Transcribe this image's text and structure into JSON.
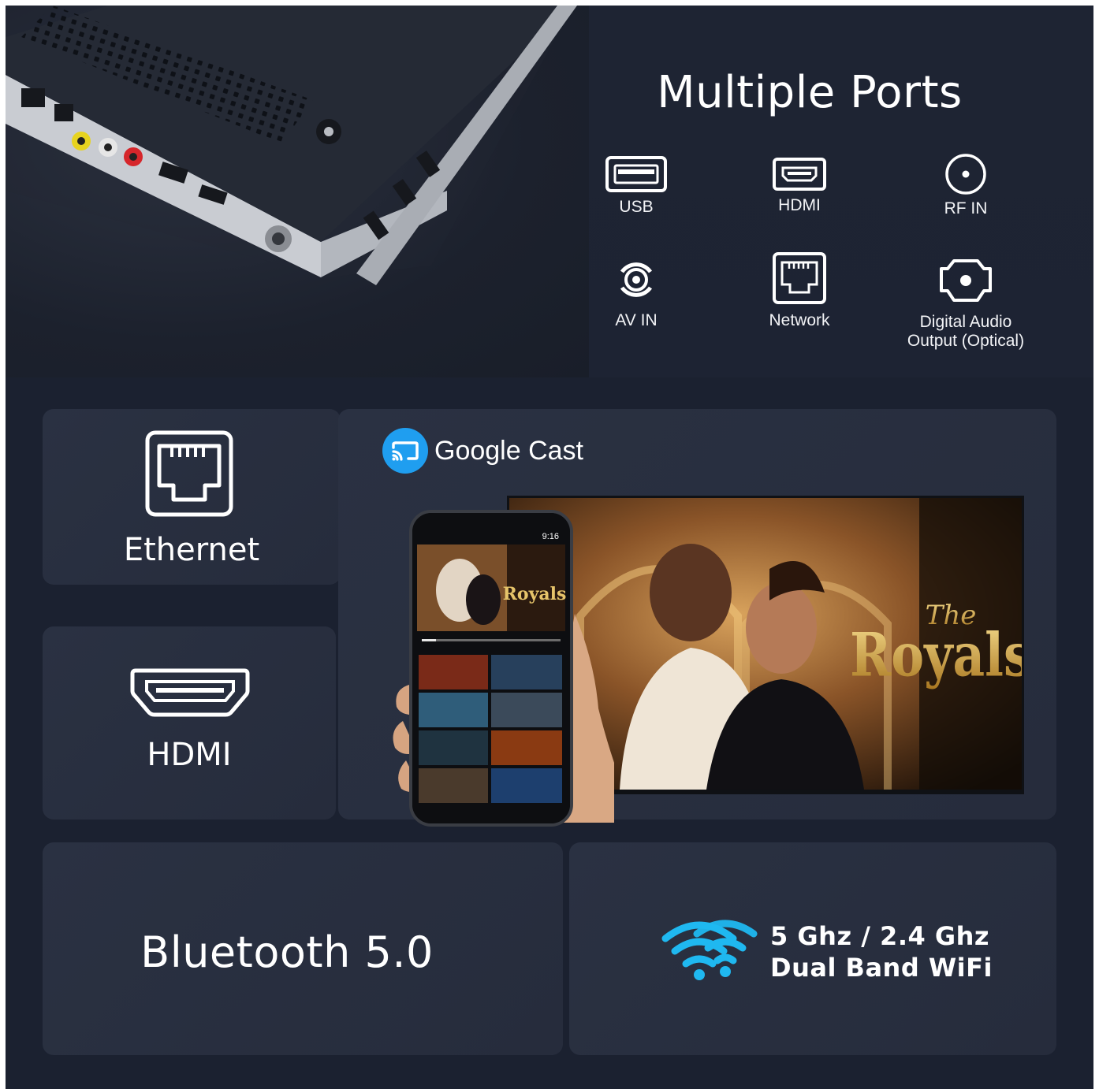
{
  "ports_section": {
    "title": "Multiple Ports",
    "ports": [
      {
        "label": "USB",
        "icon": "usb-icon"
      },
      {
        "label": "HDMI",
        "icon": "hdmi-icon"
      },
      {
        "label": "RF IN",
        "icon": "rf-in-icon"
      },
      {
        "label": "AV IN",
        "icon": "av-in-icon"
      },
      {
        "label": "Network",
        "icon": "network-port-icon"
      },
      {
        "label": "Digital Audio",
        "label2": "Output (Optical)",
        "icon": "optical-audio-icon"
      }
    ]
  },
  "features": {
    "ethernet": {
      "label": "Ethernet",
      "icon": "ethernet-icon"
    },
    "hdmi": {
      "label": "HDMI",
      "icon": "hdmi-icon"
    },
    "cast": {
      "label": "Google Cast",
      "icon": "google-cast-icon",
      "phone_time": "9:16",
      "show_title": "The Royals"
    },
    "bluetooth": {
      "label": "Bluetooth 5.0"
    },
    "wifi": {
      "line1": "5 Ghz / 2.4 Ghz",
      "line2": "Dual Band WiFi",
      "icon": "wifi-icon"
    }
  },
  "colors": {
    "background": "#1b2130",
    "card": "#2a3142",
    "accent": "#1fb8f0"
  }
}
